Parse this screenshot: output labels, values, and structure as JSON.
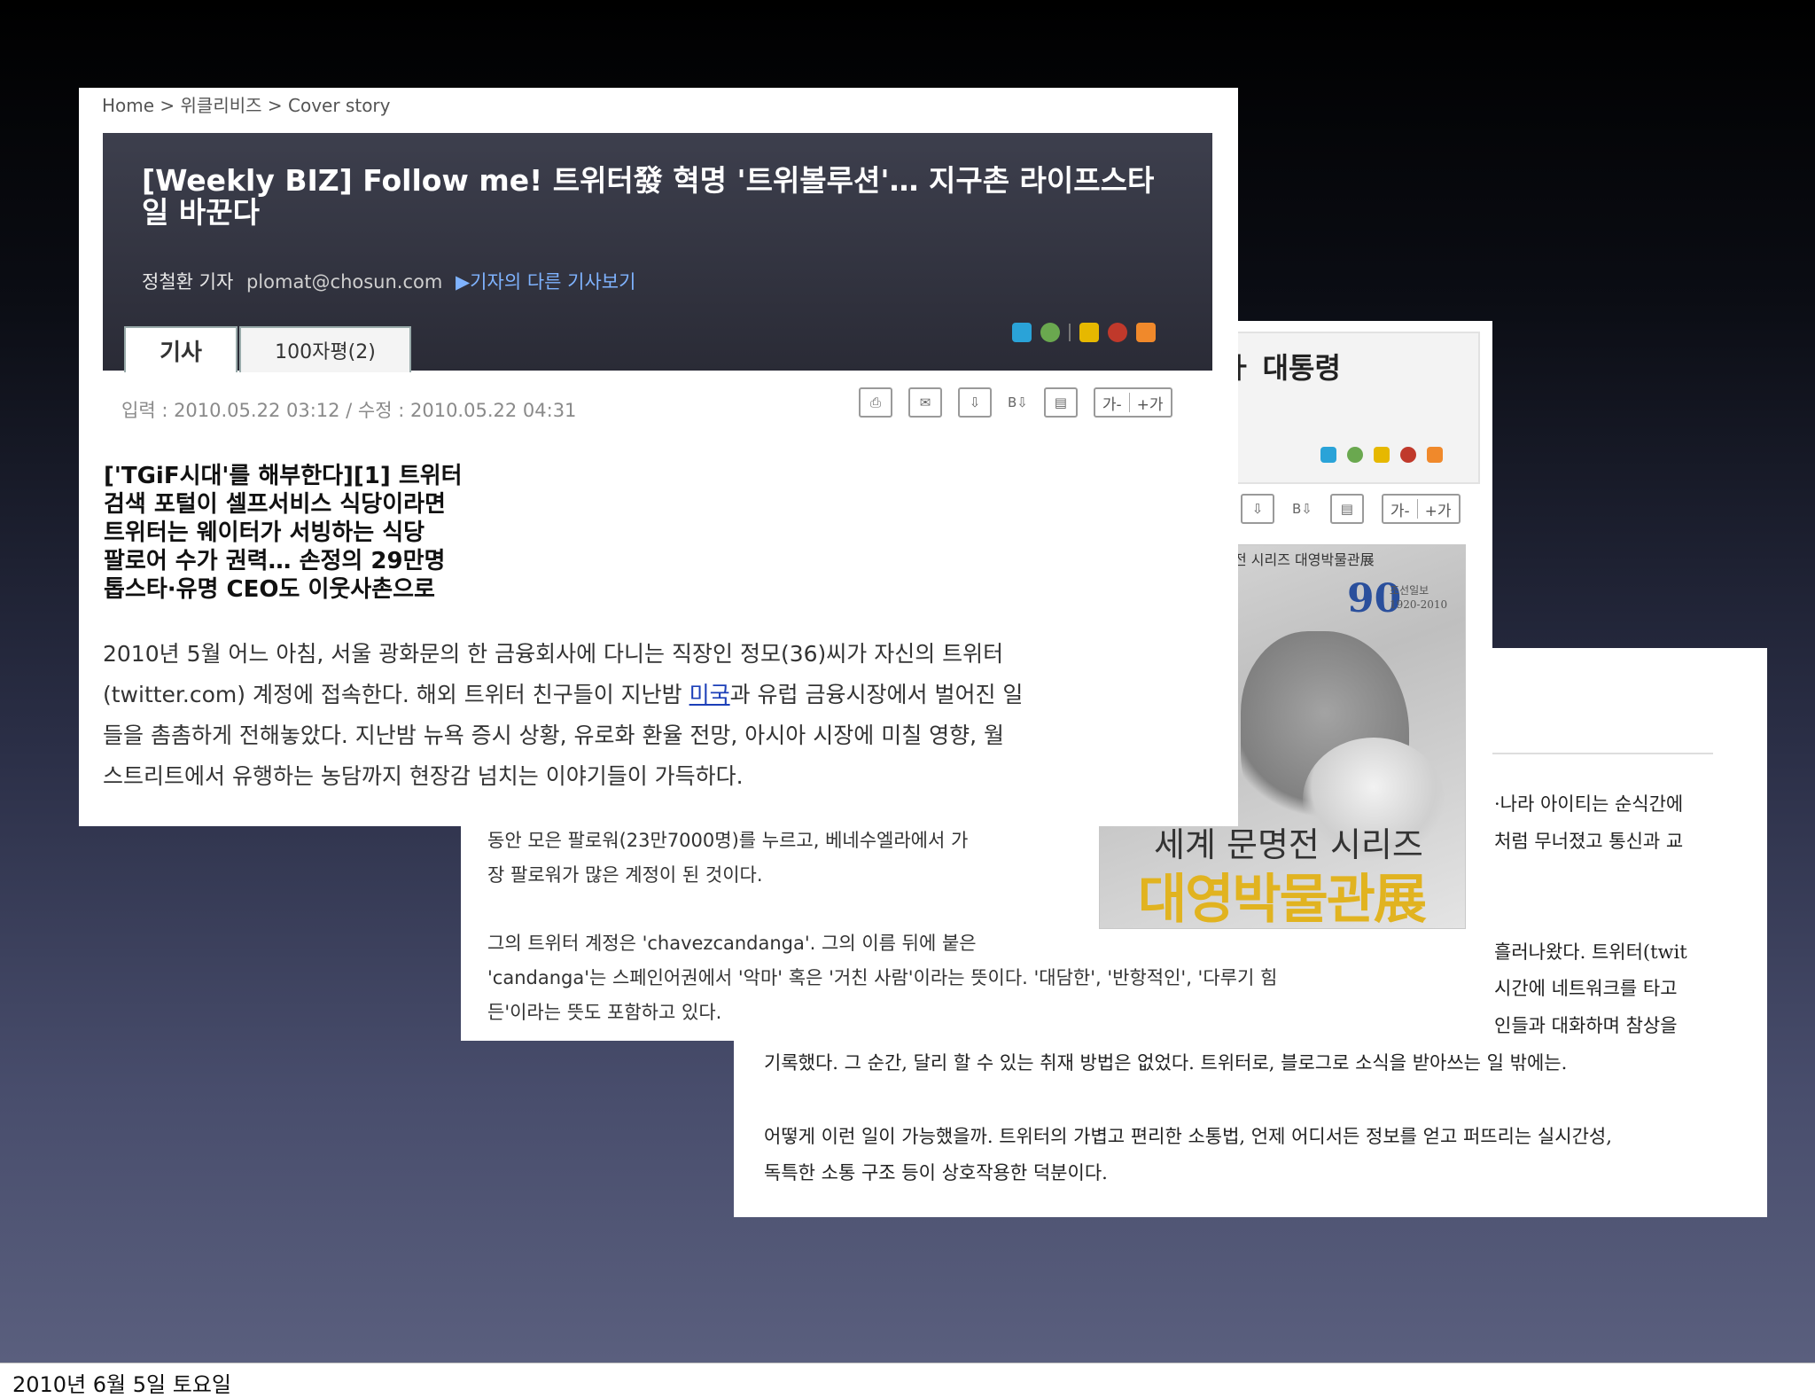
{
  "footer": {
    "date": "2010년 6월 5일 토요일"
  },
  "front": {
    "breadcrumb": "Home > 위클리비즈 > Cover story",
    "title": "[Weekly BIZ] Follow me! 트위터發 혁명 '트위볼루션'… 지구촌 라이프스타일 바꾼다",
    "byline": {
      "name": "정철환 기자",
      "email": "plomat@chosun.com",
      "more": "▶기자의 다른 기사보기"
    },
    "tabs": {
      "article": "기사",
      "comments": "100자평(2)"
    },
    "dates": "입력 : 2010.05.22 03:12 / 수정 : 2010.05.22 04:31",
    "fontsize": {
      "smaller": "가-",
      "larger": "+가"
    },
    "subheads": [
      "['TGiF시대'를 해부한다][1] 트위터",
      "검색 포털이 셀프서비스 식당이라면",
      "트위터는 웨이터가 서빙하는 식당",
      "팔로어 수가 권력… 손정의 29만명",
      "톱스타·유명 CEO도 이웃사촌으로"
    ],
    "body": {
      "line1": "2010년 5월 어느 아침, 서울 광화문의 한 금융회사에 다니는 직장인 정모(36)씨가 자신의 트위터",
      "line2_a": "(twitter.com) 계정에 접속한다. 해외 트위터 친구들이 지난밤 ",
      "line2_link": "미국",
      "line2_b": "과 유럽 금융시장에서 벌어진 일",
      "line3": "들을 촘촘하게 전해놓았다. 지난밤 뉴욕 증시 상황, 유로화 환율 전망, 아시아 시장에 미칠 영향, 월",
      "line4": "스트리트에서 유행하는 농담까지 현장감 넘치는 이야기들이 가득하다."
    }
  },
  "mid": {
    "title": "ㅏ 대통령",
    "fontsize": {
      "smaller": "가-",
      "larger": "+가"
    },
    "image_caption": "전 시리즈 대영박물관展",
    "anniv": "90",
    "anniv_sub1": "조선일보",
    "anniv_sub2": "1920-2010",
    "series1": "세계 문명전 시리즈",
    "series2": "대영박물관展",
    "lines": [
      "동안 모은 팔로워(23만7000명)를 누르고, 베네수엘라에서 가",
      "장 팔로워가 많은 계정이 된 것이다.",
      "그의 트위터 계정은 'chavezcandanga'. 그의 이름 뒤에 붙은",
      "'candanga'는 스페인어권에서 '악마' 혹은 '거친 사람'이라는 뜻이다. '대담한', '반항적인', '다루기 힘",
      "든'이라는 뜻도 포함하고 있다."
    ]
  },
  "back": {
    "right_lines": [
      "·나라 아이티는 순식간에",
      "처럼 무너졌고 통신과 교",
      "흘러나왔다. 트위터(twit",
      "시간에 네트워크를 타고",
      "인들과 대화하며 참상을"
    ],
    "para1": "기록했다. 그 순간, 달리 할 수 있는 취재 방법은 없었다. 트위터로, 블로그로 소식을 받아쓰는 일 밖에는.",
    "para2_line1": "어떻게 이런 일이 가능했을까. 트위터의 가볍고 편리한 소통법, 언제 어디서든 정보를 얻고 퍼뜨리는 실시간성,",
    "para2_line2": "독특한 소통 구조 등이 상호작용한 덕분이다."
  }
}
